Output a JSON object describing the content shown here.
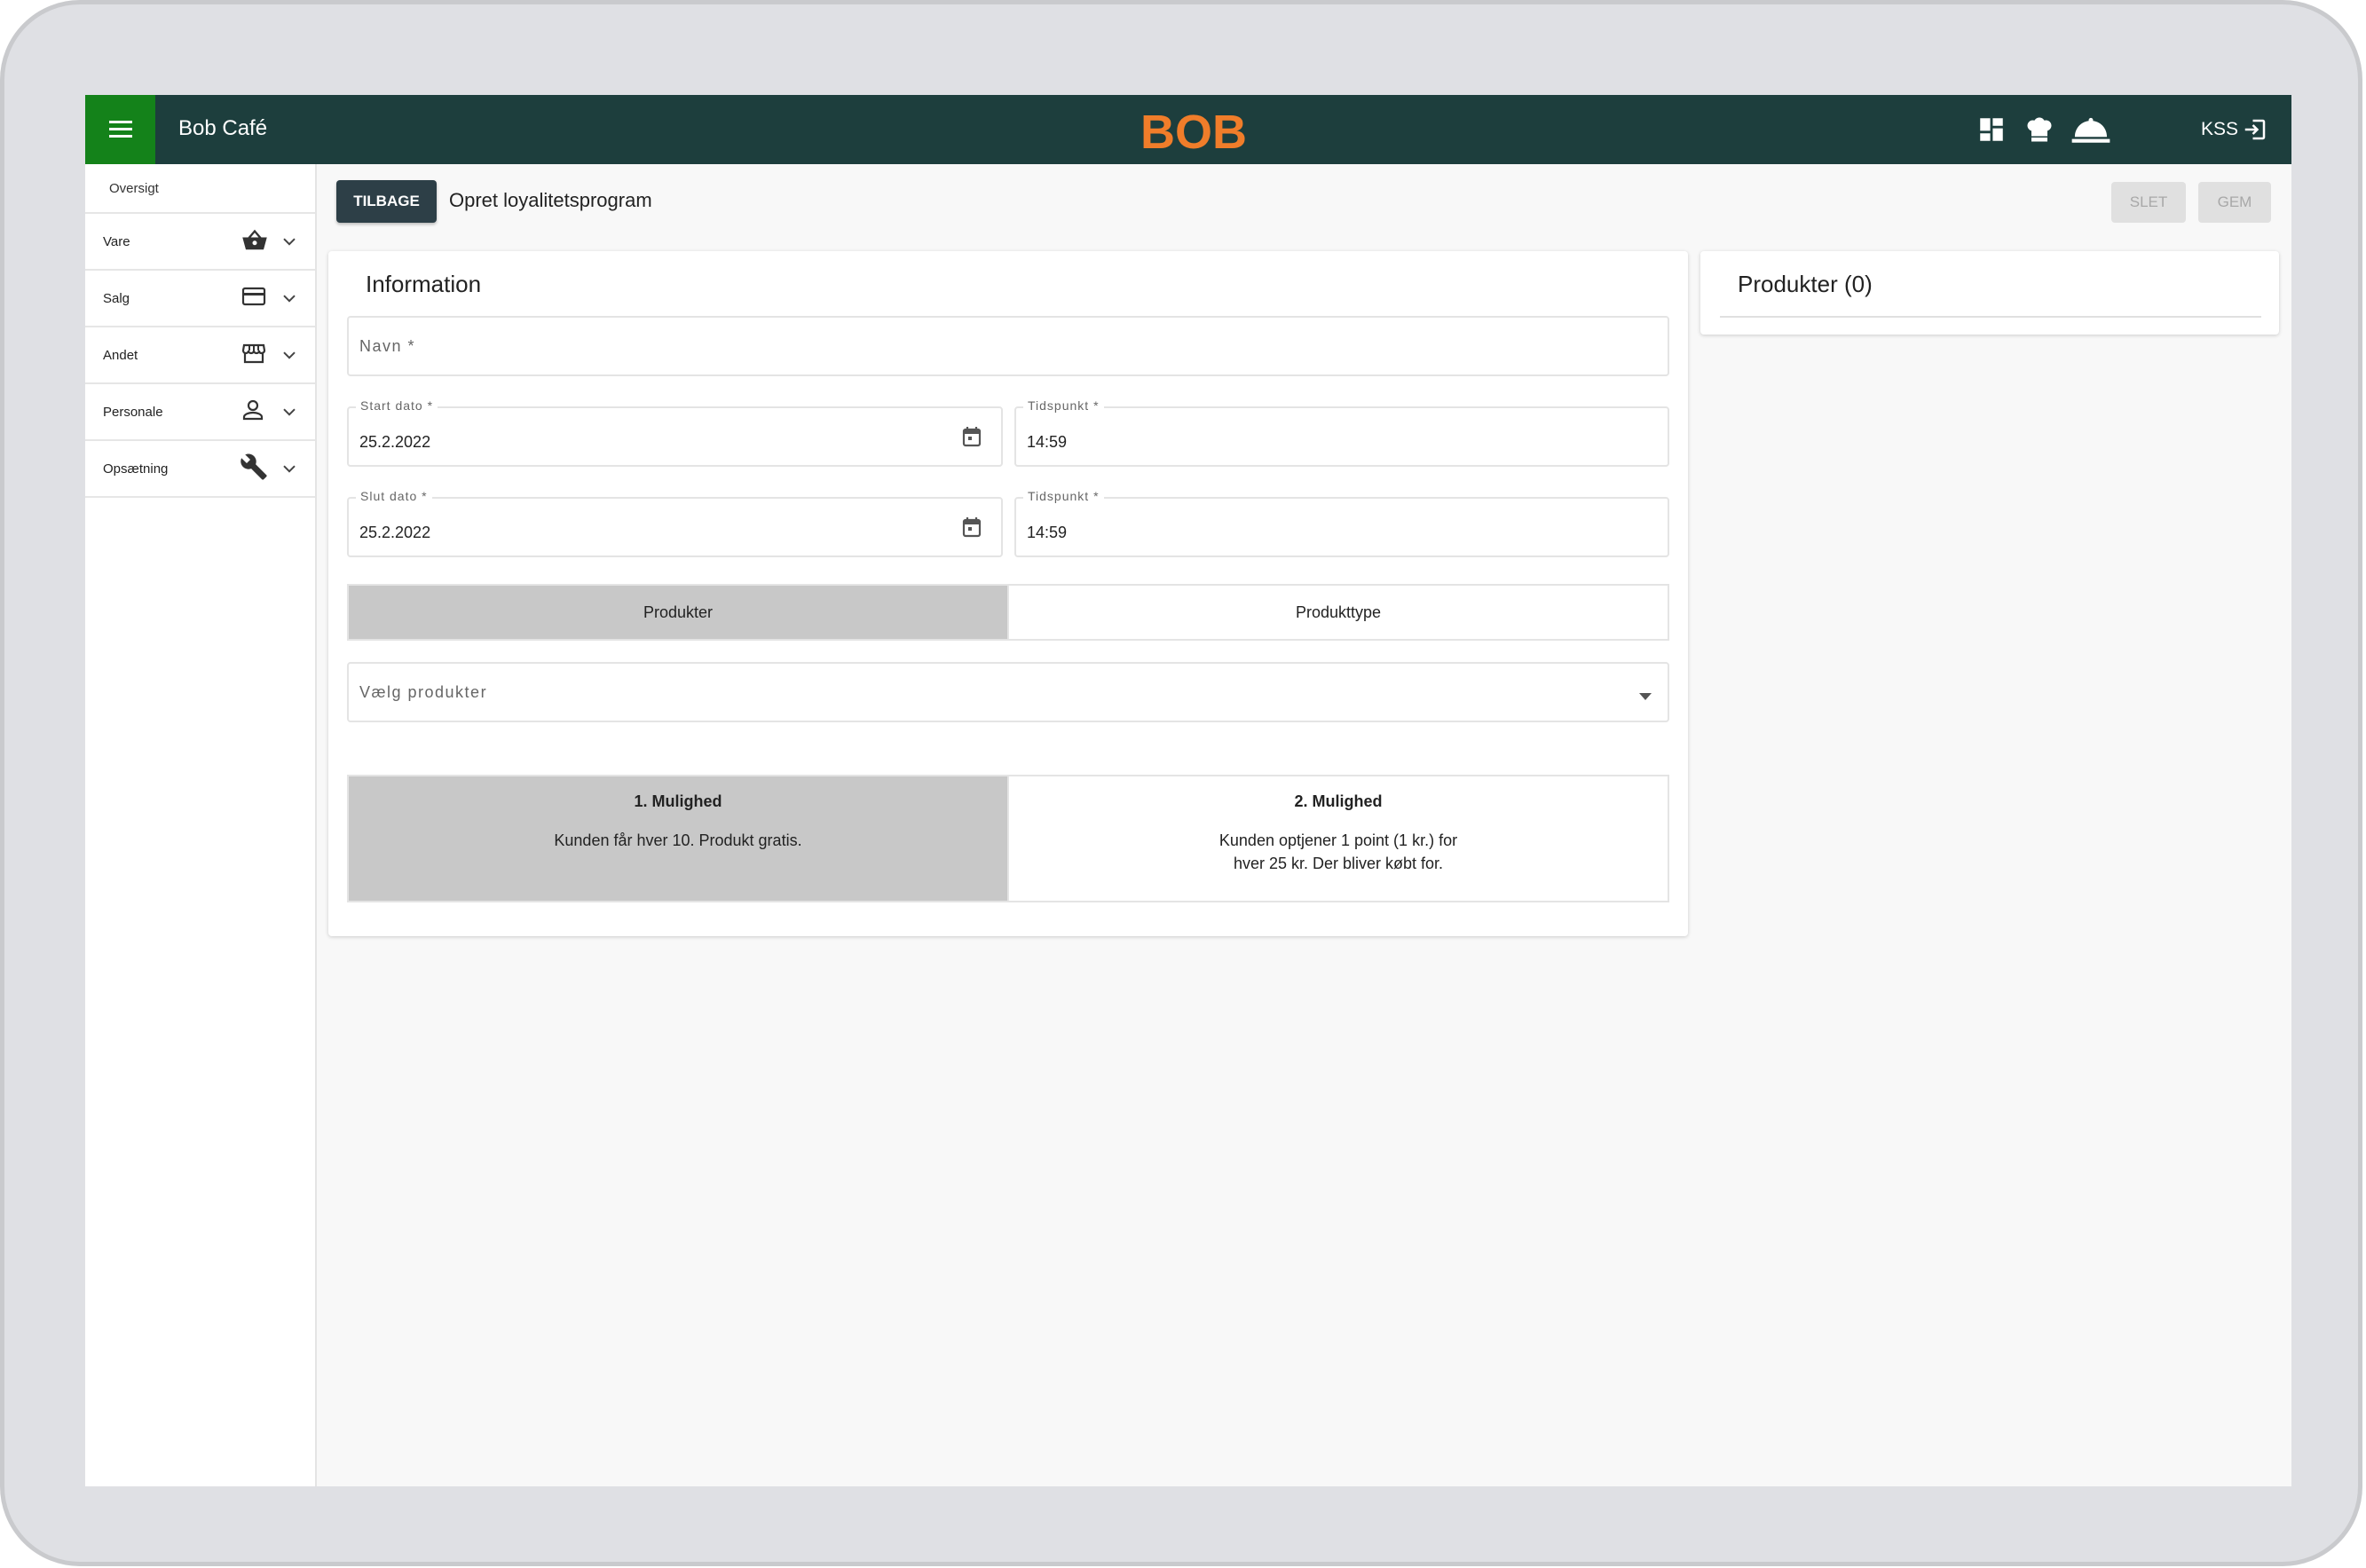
{
  "header": {
    "app_title": "Bob Café",
    "logo_text": "BOB",
    "user": "KSS"
  },
  "sidebar": {
    "items": [
      {
        "label": "Oversigt"
      },
      {
        "label": "Vare",
        "icon": "basket-icon"
      },
      {
        "label": "Salg",
        "icon": "credit-card-icon"
      },
      {
        "label": "Andet",
        "icon": "store-icon"
      },
      {
        "label": "Personale",
        "icon": "person-icon"
      },
      {
        "label": "Opsætning",
        "icon": "wrench-icon"
      }
    ]
  },
  "toolbar": {
    "back_label": "TILBAGE",
    "page_title": "Opret loyalitetsprogram",
    "delete_label": "SLET",
    "save_label": "GEM"
  },
  "form": {
    "title": "Information",
    "name_placeholder": "Navn *",
    "start_date_label": "Start dato *",
    "start_date_value": "25.2.2022",
    "start_time_label": "Tidspunkt *",
    "start_time_value": "14:59",
    "end_date_label": "Slut dato *",
    "end_date_value": "25.2.2022",
    "end_time_label": "Tidspunkt *",
    "end_time_value": "14:59",
    "toggle_products": "Produkter",
    "toggle_product_type": "Produkttype",
    "select_placeholder": "Vælg produkter",
    "option1_title": "1. Mulighed",
    "option1_desc": "Kunden får hver 10. Produkt gratis.",
    "option2_title": "2. Mulighed",
    "option2_desc_line1": "Kunden optjener 1 point (1 kr.) for",
    "option2_desc_line2": "hver 25 kr. Der bliver købt for."
  },
  "products_panel": {
    "title": "Produkter (0)"
  },
  "colors": {
    "topbar": "#1d3e3d",
    "menu_button": "#14821a",
    "logo": "#f07d2a",
    "selected_toggle": "#c8c8c8"
  }
}
